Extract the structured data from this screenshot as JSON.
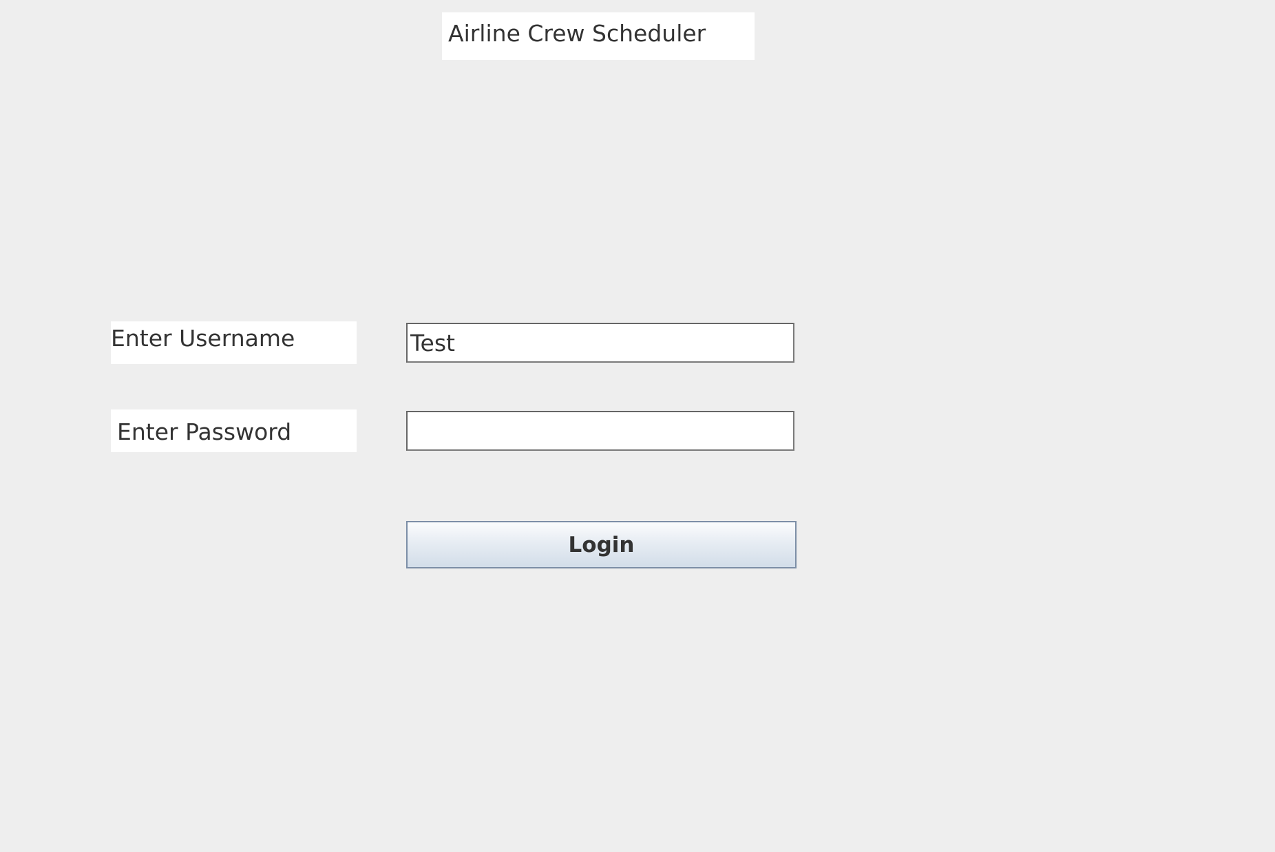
{
  "app": {
    "title": "Airline Crew Scheduler"
  },
  "form": {
    "username_label": "Enter Username",
    "username_value": "Test",
    "password_label": "Enter Password",
    "password_value": "",
    "login_label": "Login"
  }
}
